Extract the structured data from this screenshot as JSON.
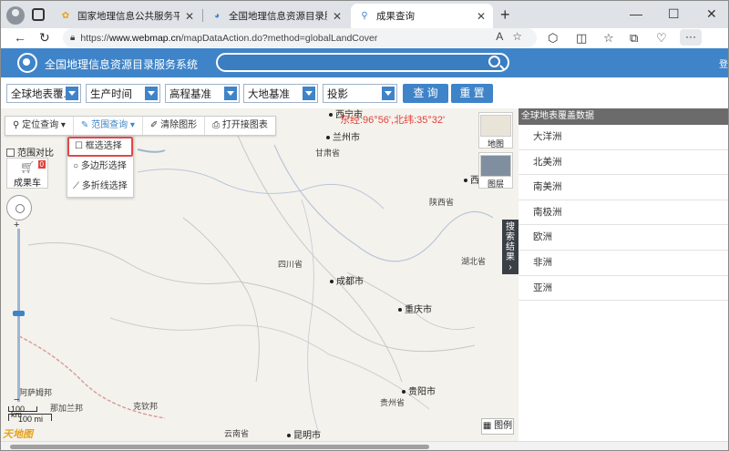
{
  "browser": {
    "tabs": [
      {
        "title": "国家地理信息公共服务平台 天地图",
        "active": false
      },
      {
        "title": "全国地理信息资源目录服务系统",
        "active": false
      },
      {
        "title": "成果查询",
        "active": true
      }
    ],
    "url_prefix": "https://",
    "url_domain": "www.webmap.cn",
    "url_path": "/mapDataAction.do?method=globalLandCover"
  },
  "header": {
    "site_title": "全国地理信息资源目录服务系统",
    "search_value": "",
    "right_text": "登"
  },
  "filters": {
    "items": [
      "全球地表覆...",
      "生产时间",
      "高程基准",
      "大地基准",
      "投影"
    ],
    "query_button": "查 询",
    "reset_button": "重 置"
  },
  "map": {
    "tools": [
      "定位查询",
      "范围查询",
      "清除图形",
      "打开接图表"
    ],
    "dropdown": [
      "框选选择",
      "多边形选择",
      "多折线选择"
    ],
    "compare_label": "范围对比",
    "cart_label": "成果车",
    "cart_count": "0",
    "coords": "东经:96°56',北纬:35°32'",
    "map_types": [
      "地图",
      "图层"
    ],
    "legend_label": "图例",
    "search_result_tab": "搜索结果",
    "scale": [
      "100 km",
      "100 mi"
    ],
    "logo_text": "天地图",
    "cities": [
      "兰州市",
      "西宁市",
      "成都市",
      "重庆市",
      "贵阳市",
      "昆明市",
      "西"
    ],
    "provinces": [
      "甘肃省",
      "陕西省",
      "四川省",
      "湖北省",
      "贵州省",
      "云南省",
      "阿萨姆邦",
      "那加兰邦",
      "克钦邦"
    ]
  },
  "sidebar": {
    "title": "全球地表覆盖数据",
    "items": [
      "大洋洲",
      "北美洲",
      "南美洲",
      "南极洲",
      "欧洲",
      "非洲",
      "亚洲"
    ]
  },
  "colors": {
    "brand_blue": "#3f84c8",
    "coords_red": "#e3413b",
    "sidebar_head": "#6b6b6b"
  }
}
